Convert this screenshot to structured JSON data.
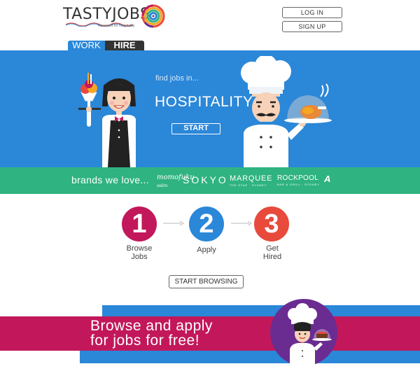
{
  "header": {
    "logo_text": "TASTYJOBS",
    "logo_tagline": "Reserved for hospitality",
    "login_label": "LOG IN",
    "signup_label": "SIGN UP"
  },
  "tabs": [
    {
      "label": "WORK",
      "active": true
    },
    {
      "label": "HIRE",
      "active": false
    }
  ],
  "hero": {
    "find_text": "find jobs in...",
    "category": "HOSPITALITY",
    "start_label": "START"
  },
  "brands": {
    "label": "brands we love...",
    "items": [
      "momofuku",
      "ssäm",
      "SOKYO",
      "MARQUEE",
      "THE STAR · SYDNEY",
      "ROCKPOOL",
      "BAR & GRILL · SYDNEY",
      "A"
    ]
  },
  "steps": [
    {
      "number": "1",
      "line1": "Browse",
      "line2": "Jobs"
    },
    {
      "number": "2",
      "line1": "Apply",
      "line2": ""
    },
    {
      "number": "3",
      "line1": "Get",
      "line2": "Hired"
    }
  ],
  "browse_button": "START BROWSING",
  "promo": {
    "line1": "Browse and apply",
    "line2": "for jobs for free!"
  },
  "colors": {
    "blue": "#2b87d8",
    "green": "#2fb380",
    "magenta": "#c2185b",
    "red": "#e84a3c",
    "purple": "#6a2c91"
  }
}
